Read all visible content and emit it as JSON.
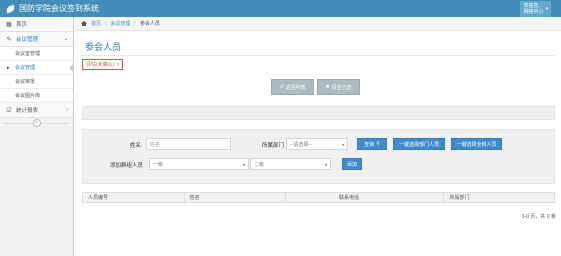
{
  "header": {
    "title": "国防学院会议签到系统",
    "user_line1": "欢迎您,",
    "user_line2": "网络中心",
    "caret": "▾"
  },
  "sidebar": {
    "home": {
      "label": "首页"
    },
    "meeting_mgmt": {
      "label": "会议管理",
      "arrow": "⌄"
    },
    "sub_items": [
      {
        "label": "会议室管理"
      },
      {
        "label": "会议管理"
      },
      {
        "label": "会议审批"
      },
      {
        "label": "会议图片库"
      }
    ],
    "stats": {
      "label": "统计报表",
      "arrow": "›"
    },
    "collapse": "«"
  },
  "breadcrumb": {
    "home": "首页",
    "section": "会议管理",
    "current": "参会人员",
    "sep": "/"
  },
  "main": {
    "title": "参会人员",
    "tag": {
      "label": "评估(未确认)",
      "close": "×"
    }
  },
  "actions": {
    "back": {
      "icon": "↺",
      "label": "返回列表"
    },
    "delete": {
      "icon": "✖",
      "label": "清空已选"
    }
  },
  "form": {
    "name_label": "姓名",
    "name_placeholder": "姓名",
    "dept_label": "所属部门",
    "dept_value": "--请选择--",
    "query_label": "查询",
    "query_icon": "⚲",
    "add_dept_all": "一键选择部门人员",
    "add_all": "一键选择全校人员",
    "group_label": "添加群组人员",
    "level1_value": "一级",
    "level2_value": "二级",
    "add_label": "添加",
    "caret": "▾"
  },
  "table": {
    "columns": [
      "人员编号",
      "姓名",
      "联系电话",
      "所属部门"
    ]
  },
  "pager": {
    "text": "1-0 页，共 0 条"
  }
}
